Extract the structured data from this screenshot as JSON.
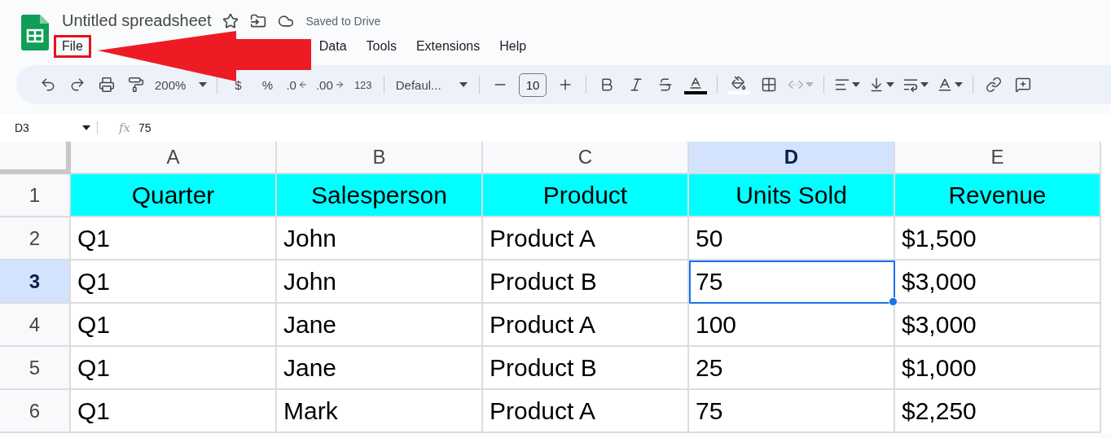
{
  "header": {
    "title": "Untitled spreadsheet",
    "starred": false,
    "save_status": "Saved to Drive"
  },
  "menu": [
    {
      "label": "File",
      "highlighted": true
    },
    {
      "label": "Data",
      "highlighted": false
    },
    {
      "label": "Tools",
      "highlighted": false
    },
    {
      "label": "Extensions",
      "highlighted": false
    },
    {
      "label": "Help",
      "highlighted": false
    }
  ],
  "annotation": {
    "kind": "arrow"
  },
  "toolbar": {
    "zoom": "200%",
    "currency": "$",
    "percent": "%",
    "decrease_decimals": ".0",
    "increase_decimals": ".00",
    "more_formats": "123",
    "font": "Defaul...",
    "font_size": "10",
    "merge_disabled": true
  },
  "formula_bar": {
    "cell_ref": "D3",
    "fx_label": "fx",
    "value": "75"
  },
  "sheet": {
    "columns": [
      {
        "label": "A",
        "selected": false
      },
      {
        "label": "B",
        "selected": false
      },
      {
        "label": "C",
        "selected": false
      },
      {
        "label": "D",
        "selected": true
      },
      {
        "label": "E",
        "selected": false
      }
    ],
    "rows": [
      {
        "number": "1",
        "selected": false,
        "header": true,
        "cells": [
          {
            "text": "Quarter",
            "active": false
          },
          {
            "text": "Salesperson",
            "active": false
          },
          {
            "text": "Product",
            "active": false
          },
          {
            "text": "Units Sold",
            "active": false
          },
          {
            "text": "Revenue",
            "active": false
          }
        ]
      },
      {
        "number": "2",
        "selected": false,
        "header": false,
        "cells": [
          {
            "text": "Q1",
            "active": false
          },
          {
            "text": "John",
            "active": false
          },
          {
            "text": "Product A",
            "active": false
          },
          {
            "text": "50",
            "active": false
          },
          {
            "text": "$1,500",
            "active": false
          }
        ]
      },
      {
        "number": "3",
        "selected": true,
        "header": false,
        "cells": [
          {
            "text": "Q1",
            "active": false
          },
          {
            "text": "John",
            "active": false
          },
          {
            "text": "Product B",
            "active": false
          },
          {
            "text": "75",
            "active": true
          },
          {
            "text": "$3,000",
            "active": false
          }
        ]
      },
      {
        "number": "4",
        "selected": false,
        "header": false,
        "cells": [
          {
            "text": "Q1",
            "active": false
          },
          {
            "text": "Jane",
            "active": false
          },
          {
            "text": "Product A",
            "active": false
          },
          {
            "text": "100",
            "active": false
          },
          {
            "text": "$3,000",
            "active": false
          }
        ]
      },
      {
        "number": "5",
        "selected": false,
        "header": false,
        "cells": [
          {
            "text": "Q1",
            "active": false
          },
          {
            "text": "Jane",
            "active": false
          },
          {
            "text": "Product B",
            "active": false
          },
          {
            "text": "25",
            "active": false
          },
          {
            "text": "$1,000",
            "active": false
          }
        ]
      },
      {
        "number": "6",
        "selected": false,
        "header": false,
        "cells": [
          {
            "text": "Q1",
            "active": false
          },
          {
            "text": "Mark",
            "active": false
          },
          {
            "text": "Product A",
            "active": false
          },
          {
            "text": "75",
            "active": false
          },
          {
            "text": "$2,250",
            "active": false
          }
        ]
      }
    ]
  }
}
